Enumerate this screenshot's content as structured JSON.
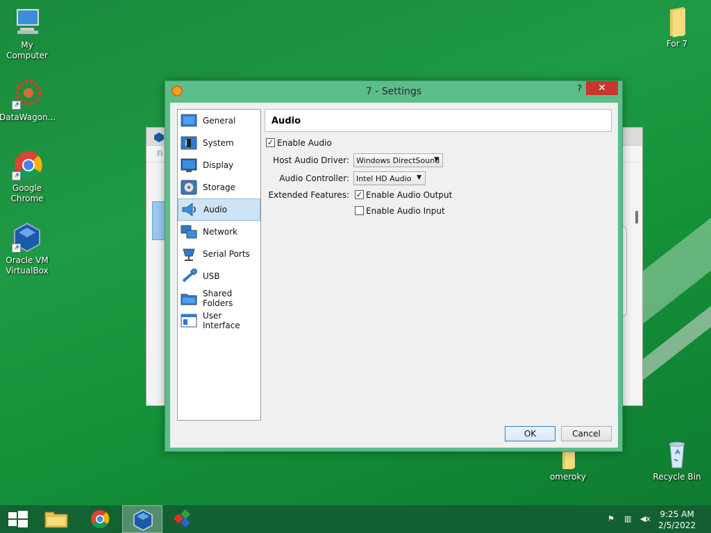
{
  "desktop": {
    "icons": [
      {
        "label": "My Computer"
      },
      {
        "label": "DataWagon..."
      },
      {
        "label": "Google Chrome"
      },
      {
        "label": "Oracle VM VirtualBox"
      },
      {
        "label": "For 7"
      },
      {
        "label": "omeroky"
      },
      {
        "label": "Recycle Bin"
      }
    ]
  },
  "background_window": {
    "partial_text": "Fi"
  },
  "window": {
    "title": "7 - Settings",
    "help_label": "?",
    "close_label": "✕"
  },
  "nav": {
    "items": [
      {
        "label": "General",
        "icon": "general-icon"
      },
      {
        "label": "System",
        "icon": "system-icon"
      },
      {
        "label": "Display",
        "icon": "display-icon"
      },
      {
        "label": "Storage",
        "icon": "storage-icon"
      },
      {
        "label": "Audio",
        "icon": "audio-icon",
        "selected": true
      },
      {
        "label": "Network",
        "icon": "network-icon"
      },
      {
        "label": "Serial Ports",
        "icon": "serial-ports-icon"
      },
      {
        "label": "USB",
        "icon": "usb-icon"
      },
      {
        "label": "Shared Folders",
        "icon": "shared-folders-icon"
      },
      {
        "label": "User Interface",
        "icon": "user-interface-icon"
      }
    ]
  },
  "audio": {
    "header": "Audio",
    "enable_audio_label": "Enable Audio",
    "enable_audio_checked": true,
    "host_driver_label": "Host Audio Driver:",
    "host_driver_value": "Windows DirectSound",
    "controller_label": "Audio Controller:",
    "controller_value": "Intel HD Audio",
    "extended_label": "Extended Features:",
    "output_label": "Enable Audio Output",
    "output_checked": true,
    "input_label": "Enable Audio Input",
    "input_checked": false
  },
  "buttons": {
    "ok": "OK",
    "cancel": "Cancel"
  },
  "taskbar": {
    "time": "9:25 AM",
    "date": "2/5/2022"
  },
  "colors": {
    "window_frame": "#5cbd8a",
    "close": "#c7372c",
    "selection": "#cde4f7"
  }
}
